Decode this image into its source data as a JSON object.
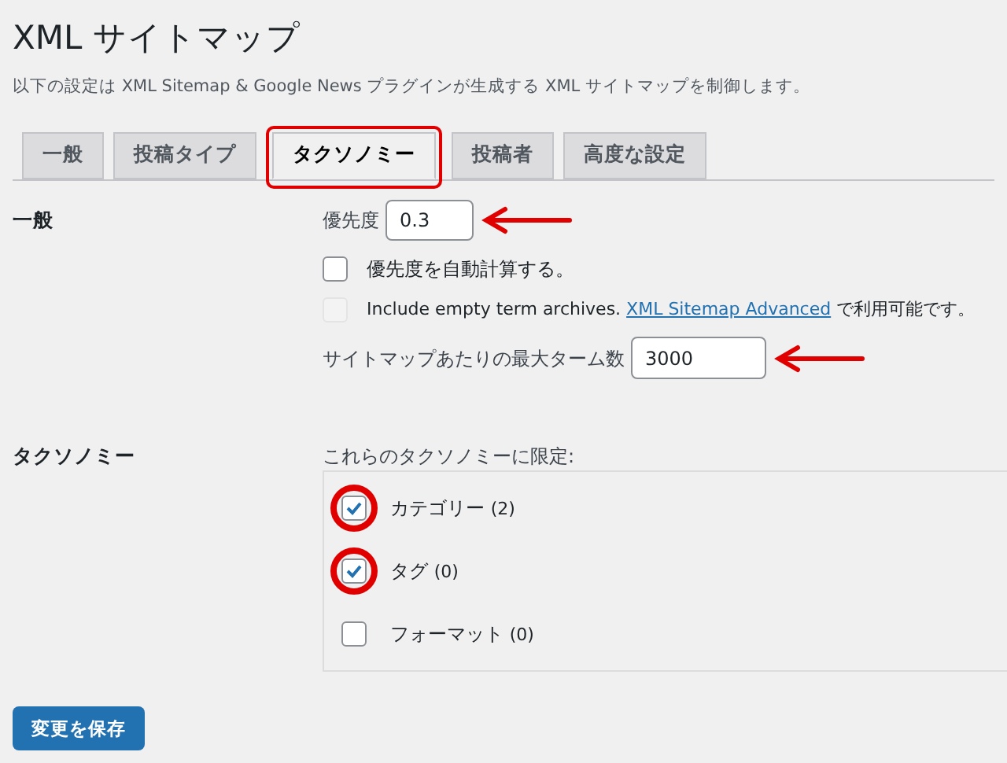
{
  "title": "XML サイトマップ",
  "description": "以下の設定は XML Sitemap & Google News プラグインが生成する XML サイトマップを制御します。",
  "tabs": [
    {
      "label": "一般",
      "selected": false,
      "highlighted": false
    },
    {
      "label": "投稿タイプ",
      "selected": false,
      "highlighted": false
    },
    {
      "label": "タクソノミー",
      "selected": true,
      "highlighted": true
    },
    {
      "label": "投稿者",
      "selected": false,
      "highlighted": false
    },
    {
      "label": "高度な設定",
      "selected": false,
      "highlighted": false
    }
  ],
  "general": {
    "heading": "一般",
    "priority": {
      "label": "優先度",
      "value": "0.3",
      "arrow": true
    },
    "auto_priority": {
      "label": "優先度を自動計算する。",
      "checked": false,
      "disabled": false
    },
    "empty_terms": {
      "label": "Include empty term archives.",
      "link": "XML Sitemap Advanced",
      "suffix": "で利用可能です。",
      "checked": false,
      "disabled": true
    },
    "max_terms": {
      "label": "サイトマップあたりの最大ターム数",
      "value": "3000",
      "arrow": true
    }
  },
  "taxonomies": {
    "heading": "タクソノミー",
    "legend": "これらのタクソノミーに限定:",
    "items": [
      {
        "label": "カテゴリー",
        "count": "(2)",
        "checked": true,
        "circled": true
      },
      {
        "label": "タグ",
        "count": "(0)",
        "checked": true,
        "circled": true
      },
      {
        "label": "フォーマット",
        "count": "(0)",
        "checked": false,
        "circled": false
      }
    ]
  },
  "save_button": "変更を保存"
}
